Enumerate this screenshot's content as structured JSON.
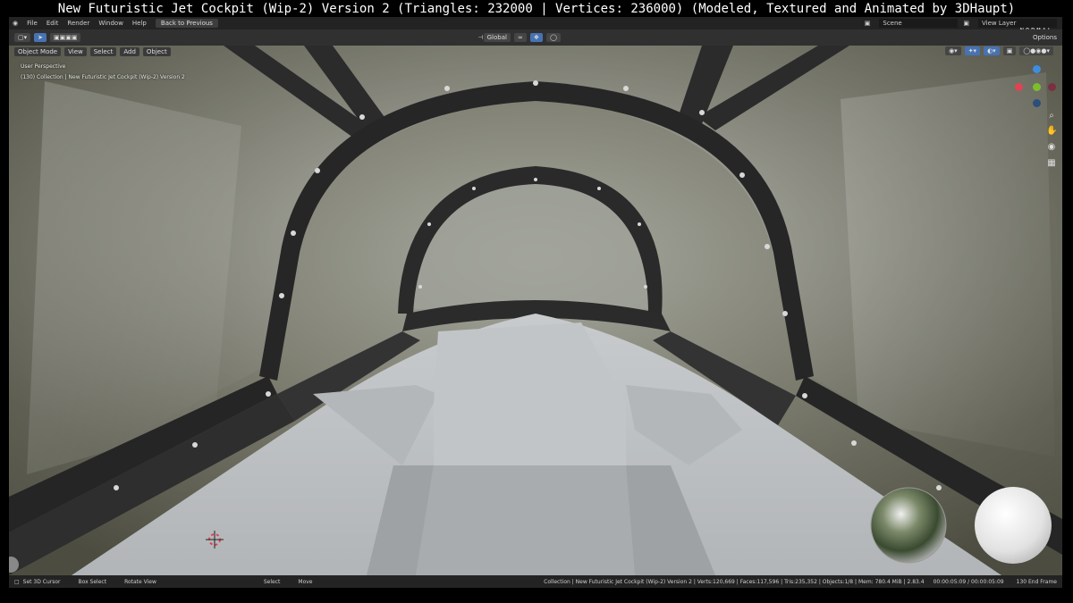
{
  "caption": "New Futuristic Jet Cockpit (Wip-2) Version 2 (Triangles: 232000 | Vertices: 236000)  (Modeled, Textured and Animated by 3DHaupt)",
  "menu": {
    "file": "File",
    "edit": "Edit",
    "render": "Render",
    "window": "Window",
    "help": "Help",
    "back": "Back to Previous"
  },
  "topright": {
    "scene": "Scene",
    "view_layer": "View Layer",
    "normal": "NORMAL",
    "options": "Options"
  },
  "header": {
    "transform_orientation": "Global"
  },
  "subheader": {
    "mode": "Object Mode",
    "view": "View",
    "select": "Select",
    "add": "Add",
    "object": "Object"
  },
  "viewport_info": {
    "perspective": "User Perspective",
    "collection": "(130) Collection | New Futuristic Jet Cockpit (Wip-2) Version 2"
  },
  "status": {
    "set_cursor": "Set 3D Cursor",
    "box_select": "Box Select",
    "rotate_view": "Rotate View",
    "select": "Select",
    "move": "Move",
    "info": "Collection | New Futuristic Jet Cockpit (Wip-2) Version 2 | Verts:120,669 | Faces:117,596 | Tris:235,352 | Objects:1/8 | Mem: 780.4 MiB | 2.83.4",
    "time": "00:00:05:09 / 00:00:05:09",
    "frame": "130 End Frame"
  },
  "colors": {
    "accent": "#4772b3",
    "x_axis": "#e04353",
    "y_axis": "#7cbf2a",
    "z_axis": "#3c8de0"
  }
}
